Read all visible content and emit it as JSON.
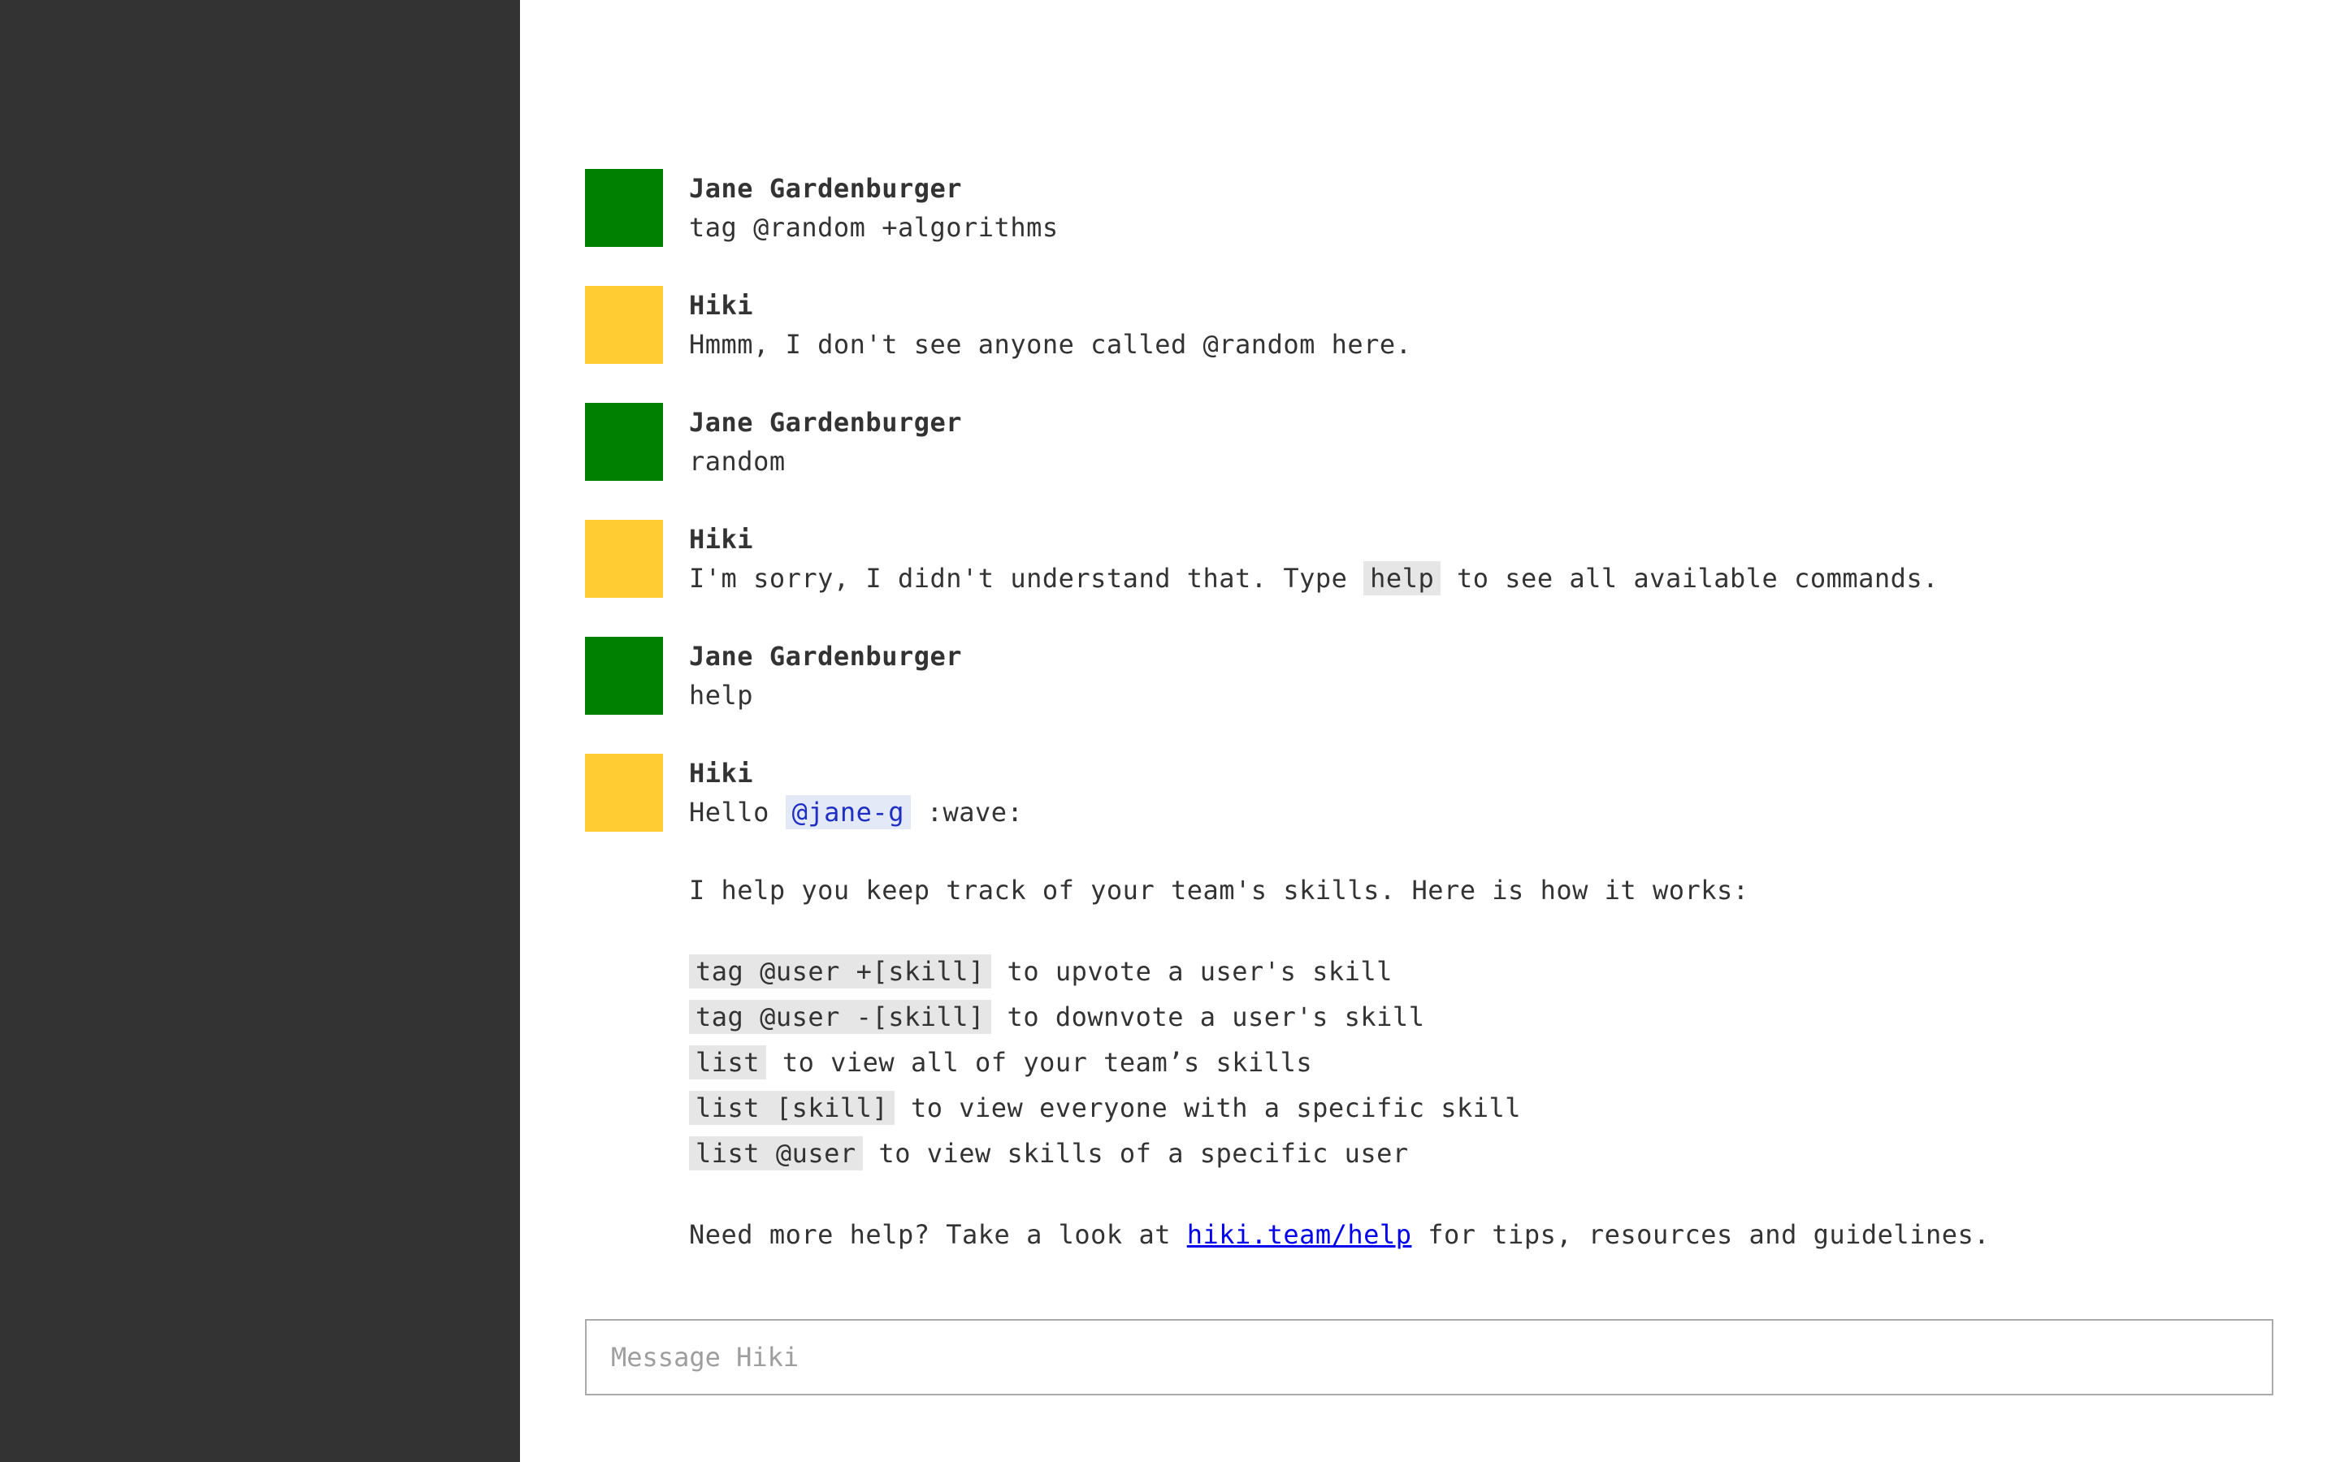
{
  "colors": {
    "sidebar_bg": "#333333",
    "user_avatar": "#008000",
    "bot_avatar": "#ffcc33",
    "code_bg": "#e6e6e6",
    "mention_fg": "#1f2fc4",
    "link": "#0000ee"
  },
  "messages": [
    {
      "author": "Jane Gardenburger",
      "text": "tag @random +algorithms"
    },
    {
      "author": "Hiki",
      "text": "Hmmm, I don't see anyone called @random here."
    },
    {
      "author": "Jane Gardenburger",
      "text": "random"
    },
    {
      "author": "Hiki",
      "before": "I'm sorry, I didn't understand that. Type",
      "code": "help",
      "after": "to see all available commands."
    },
    {
      "author": "Jane Gardenburger",
      "text": "help"
    },
    {
      "author": "Hiki",
      "greeting": "Hello",
      "mention": "@jane-g",
      "emoji": ":wave:",
      "intro": "I help you keep track of your team's skills. Here is how it works:",
      "commands": [
        {
          "code": "tag @user +[skill]",
          "desc": "to upvote a user's skill"
        },
        {
          "code": "tag @user -[skill]",
          "desc": "to downvote a user's skill"
        },
        {
          "code": "list",
          "desc": "to view all of your team’s skills"
        },
        {
          "code": "list [skill]",
          "desc": "to view everyone with a specific skill"
        },
        {
          "code": "list @user",
          "desc": "to view skills of a specific user"
        }
      ],
      "help_before": "Need more help? Take a look at",
      "help_link": "hiki.team/help",
      "help_after": "for tips, resources and guidelines."
    }
  ],
  "composer": {
    "placeholder": "Message Hiki",
    "value": ""
  }
}
